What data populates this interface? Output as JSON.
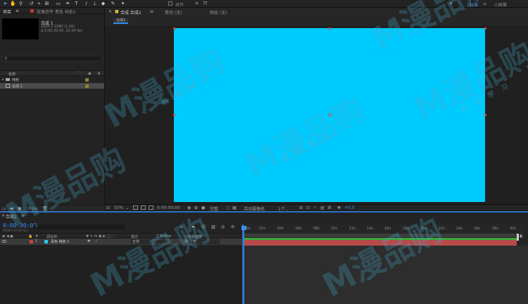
{
  "toolbar": {
    "workspace_labels": [
      "对齐"
    ],
    "workspace_options": [
      "标准",
      "小屏幕"
    ]
  },
  "project_panel": {
    "tab_project": "项目",
    "tab_effect_controls": "效果控件 青色 纯色1",
    "comp_name": "合成 1",
    "comp_info": [
      "1920 x 1080 (1.00)",
      "Δ 0:00:30:00, 25.00 fps"
    ],
    "col_name": "名称",
    "items": [
      {
        "label": "纯色",
        "type": "folder"
      },
      {
        "label": "合成 1",
        "type": "comp",
        "selected": true
      }
    ],
    "bottom_label": "8 bpc"
  },
  "comp_viewer": {
    "tab_label": "合成 合成1",
    "material_tab": "素材 (无)",
    "layer_tab": "图层 (无)",
    "comp_tab_chip": "合成1",
    "zoom": "50%",
    "timecode": "0:00:00:00",
    "resolution": "完整",
    "camera": "活动摄像机",
    "views": "1个...",
    "exposure": "+0.0"
  },
  "timeline": {
    "tab_label": "合成1",
    "timecode": "0:00:00:00",
    "frames": "00000 (25.00 fps)",
    "headers": {
      "source_name": "源名称",
      "mode": "模式",
      "trkmat": "T TrkMat",
      "parent": "父级和链接"
    },
    "layer": {
      "number": "1",
      "name": "青色 纯色 1",
      "mode": "正常",
      "parent": "无"
    },
    "ruler_labels": [
      "0s",
      "02s",
      "04s",
      "06s",
      "08s",
      "10s",
      "12s",
      "14s",
      "16s",
      "18s",
      "20s",
      "22s",
      "24s",
      "26s",
      "28s",
      "30s"
    ]
  },
  "watermark": {
    "logo_text": "M漫品购",
    "sub_text": "教 程 学 习"
  },
  "colors": {
    "accent": "#2e8ff0",
    "canvas": "#00cbff",
    "layer_label": "#2dc5f0",
    "track": "#b84a4a"
  }
}
